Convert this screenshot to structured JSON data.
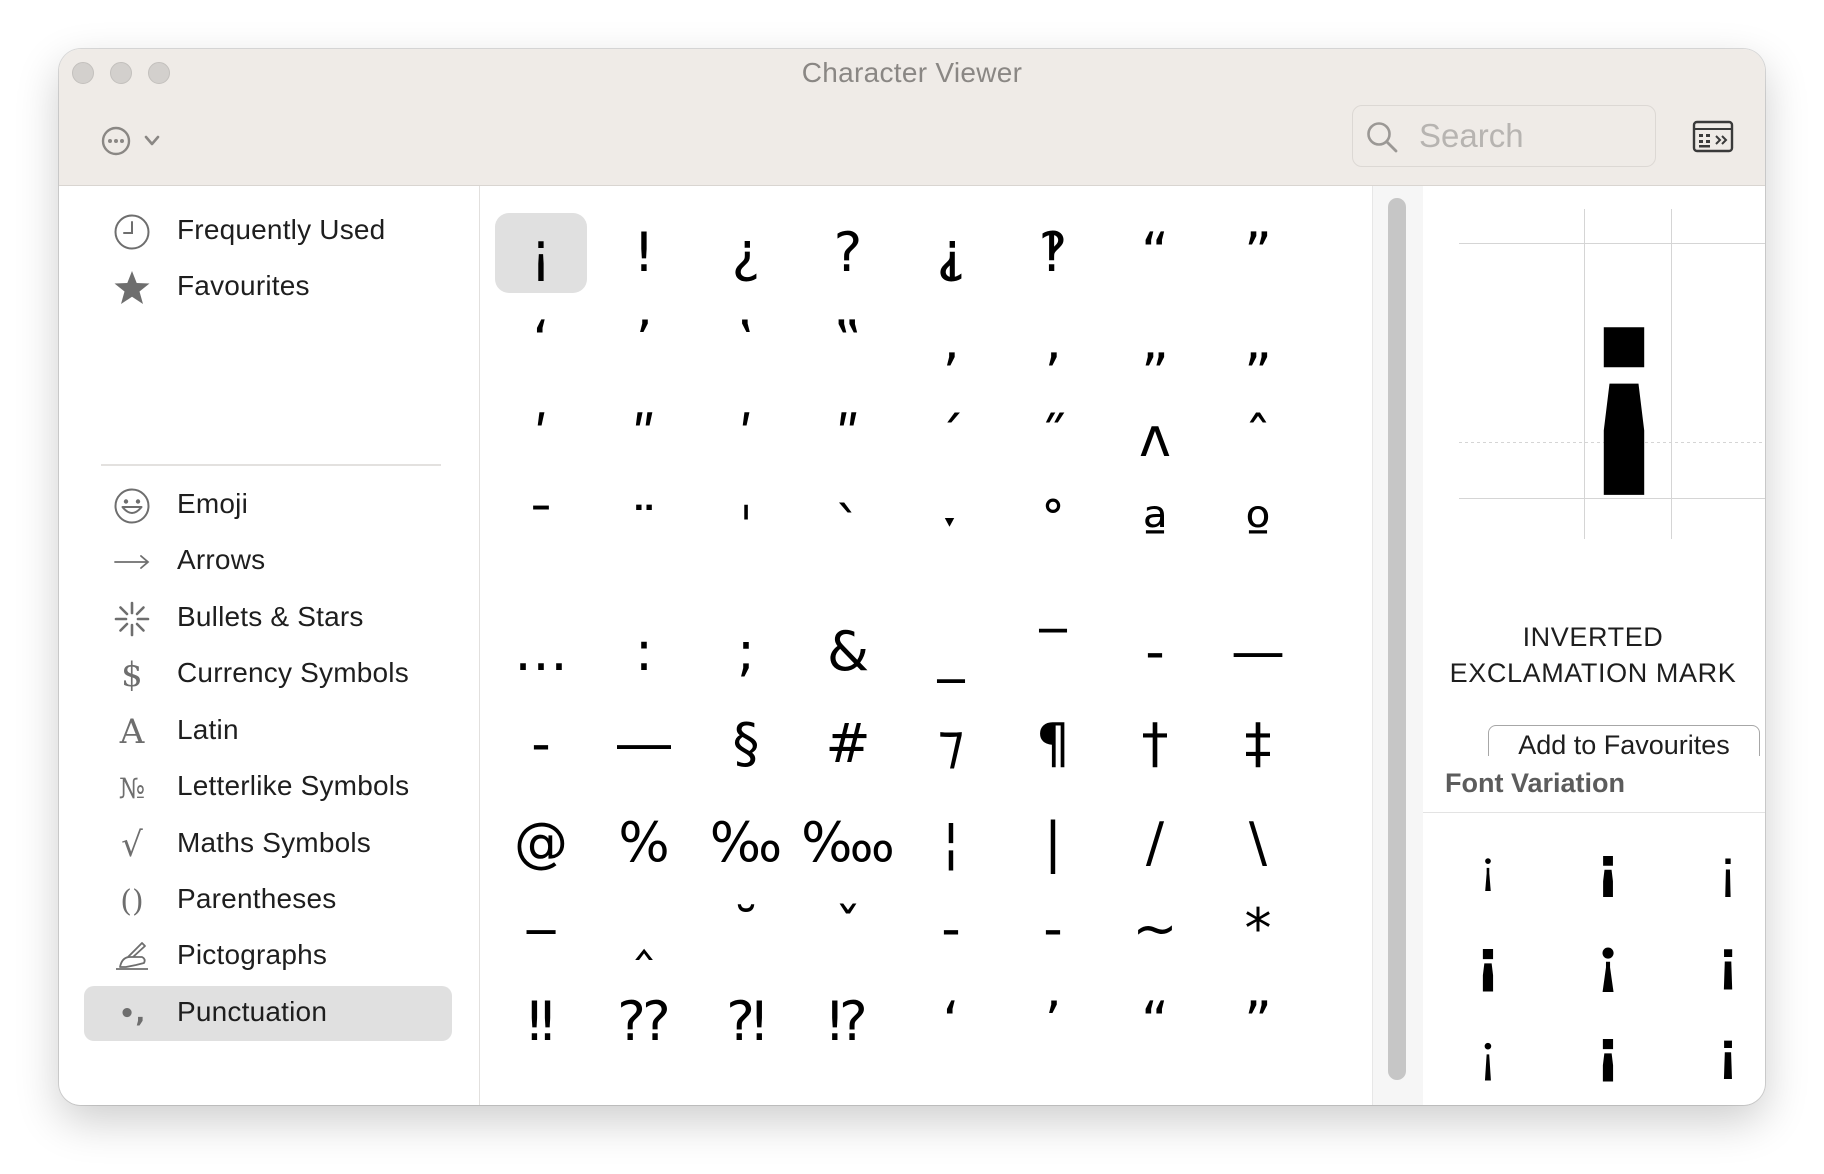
{
  "window": {
    "title": "Character Viewer"
  },
  "toolbar": {
    "action_icon": "ellipsis-circle-icon",
    "chevron_icon": "chevron-down-icon",
    "search_placeholder": "Search",
    "keyboard_icon": "keyboard-viewer-icon"
  },
  "sidebar": {
    "items": [
      {
        "label": "Frequently Used",
        "icon": "clock-icon"
      },
      {
        "label": "Favourites",
        "icon": "star-icon"
      },
      {
        "label": "Emoji",
        "icon": "smiley-icon"
      },
      {
        "label": "Arrows",
        "icon": "arrow-icon"
      },
      {
        "label": "Bullets & Stars",
        "icon": "asterisk-icon"
      },
      {
        "label": "Currency Symbols",
        "icon": "dollar-icon",
        "glyph": "$"
      },
      {
        "label": "Latin",
        "icon": "latin-a-icon",
        "glyph": "A"
      },
      {
        "label": "Letterlike Symbols",
        "icon": "numero-icon",
        "glyph": "№"
      },
      {
        "label": "Maths Symbols",
        "icon": "square-root-icon",
        "glyph": "√"
      },
      {
        "label": "Parentheses",
        "icon": "parentheses-icon",
        "glyph": "()"
      },
      {
        "label": "Pictographs",
        "icon": "writing-hand-icon"
      },
      {
        "label": "Punctuation",
        "icon": "punctuation-icon",
        "glyph": "•,",
        "selected": true
      }
    ]
  },
  "grid": {
    "selected": "¡",
    "rows": [
      [
        "¡",
        "!",
        "¿",
        "?",
        "⸘",
        "‽",
        "“",
        "”"
      ],
      [
        "‘",
        "’",
        "‛",
        "‟",
        "‚",
        "‚",
        "„",
        "„"
      ],
      [
        "ʹ",
        "ʺ",
        "ʹ",
        "ʺ",
        "ˊ",
        "˝",
        "ʌ",
        "ˆ"
      ],
      [
        "ˉ",
        "¨",
        "ˈ",
        "`",
        "ˑ",
        "˚",
        "ª",
        "º"
      ],
      [
        "…",
        ":",
        ";",
        "&",
        "_",
        "‾",
        "‐",
        "—"
      ],
      [
        "‑",
        "―",
        "§",
        "#",
        "⁊",
        "¶",
        "†",
        "‡"
      ],
      [
        "@",
        "%",
        "‰",
        "‱",
        "¦",
        "|",
        "/",
        "\\"
      ],
      [
        "‒",
        "‸",
        "˘",
        "ˇ",
        "‐",
        "‑",
        "~",
        "*"
      ],
      [
        "‼",
        "⁇",
        "⁈",
        "⁉",
        "ʻ",
        "ʼ",
        "“",
        "”"
      ],
      [
        "❢",
        "❣",
        "⁋",
        "",
        "",
        "",
        "",
        ""
      ]
    ]
  },
  "detail": {
    "glyph": "¡",
    "name_line1": "INVERTED",
    "name_line2": "EXCLAMATION MARK",
    "add_favourites_label": "Add to Favourites",
    "font_variation_title": "Font Variation",
    "variations": [
      "¡",
      "¡",
      "¡",
      "¡",
      "¡",
      "¡",
      "¡",
      "¡",
      "¡"
    ]
  },
  "colors": {
    "selection": "#e0e0e0",
    "titlebar": "#efebe7",
    "sidebar_text": "#1e1e1e"
  }
}
